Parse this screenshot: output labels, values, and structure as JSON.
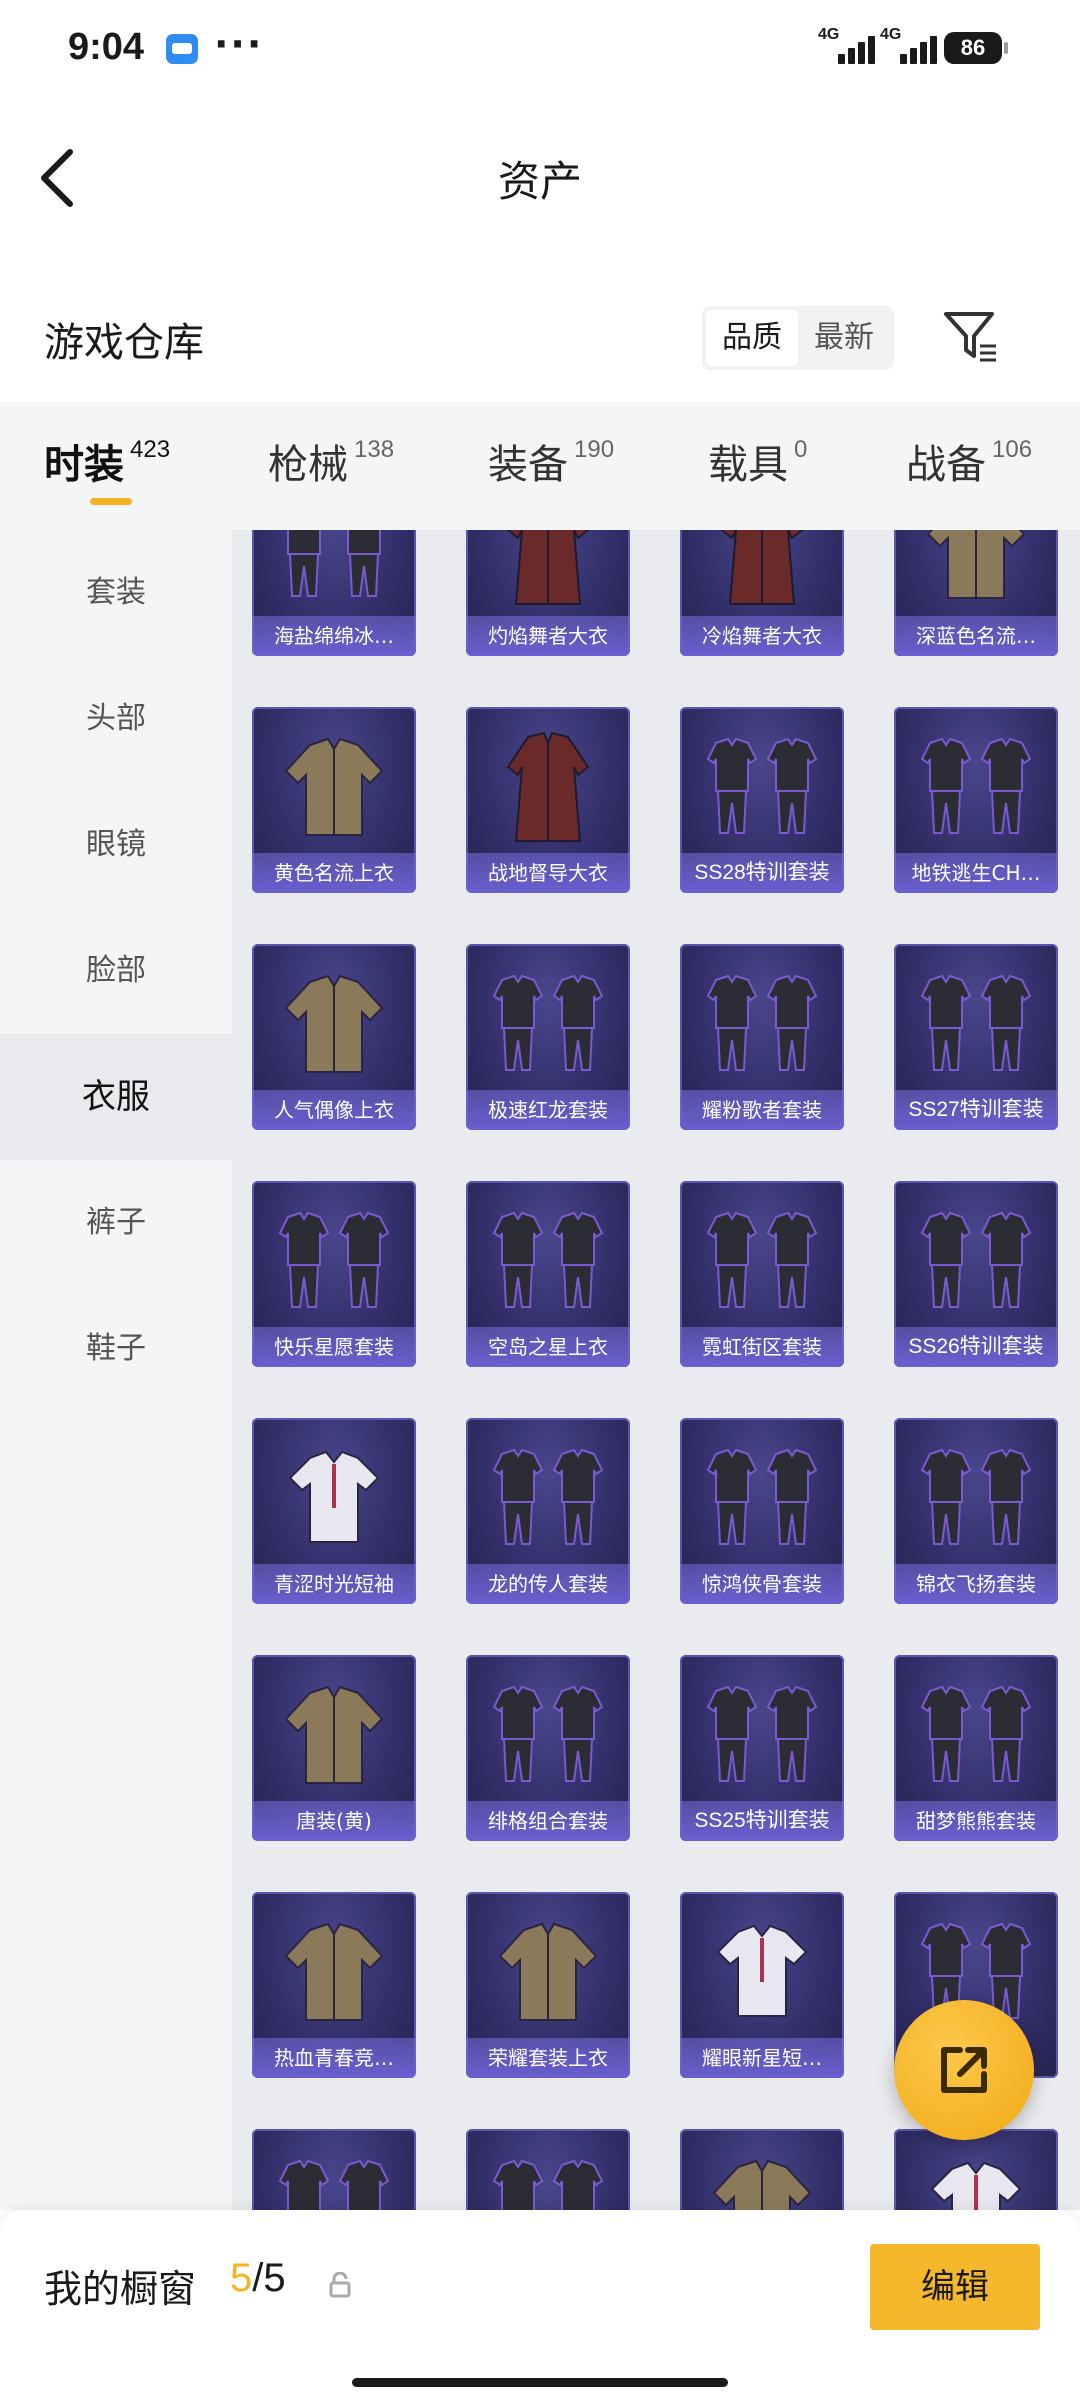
{
  "status_bar": {
    "time": "9:04",
    "more": "···",
    "network_1": "4G",
    "network_2": "4G",
    "battery": "86"
  },
  "nav": {
    "title": "资产"
  },
  "warehouse": {
    "title": "游戏仓库",
    "sort_options": [
      "品质",
      "最新"
    ],
    "active_sort": "品质"
  },
  "tabs": [
    {
      "label": "时装",
      "count": "423",
      "active": true
    },
    {
      "label": "枪械",
      "count": "138"
    },
    {
      "label": "装备",
      "count": "190"
    },
    {
      "label": "载具",
      "count": "0"
    },
    {
      "label": "战备",
      "count": "106"
    }
  ],
  "sidebar": {
    "items": [
      {
        "label": "套装"
      },
      {
        "label": "头部"
      },
      {
        "label": "眼镜"
      },
      {
        "label": "脸部"
      },
      {
        "label": "衣服",
        "active": true
      },
      {
        "label": "裤子"
      },
      {
        "label": "鞋子"
      }
    ]
  },
  "items": [
    {
      "name": "海盐绵绵冰…",
      "art": "outfit-set"
    },
    {
      "name": "灼焰舞者大衣",
      "art": "coat"
    },
    {
      "name": "冷焰舞者大衣",
      "art": "coat"
    },
    {
      "name": "深蓝色名流…",
      "art": "jacket"
    },
    {
      "name": "黄色名流上衣",
      "art": "jacket"
    },
    {
      "name": "战地督导大衣",
      "art": "coat"
    },
    {
      "name": "SS28特训套装",
      "art": "outfit-set"
    },
    {
      "name": "地铁逃生CH…",
      "art": "outfit-set"
    },
    {
      "name": "人气偶像上衣",
      "art": "jacket"
    },
    {
      "name": "极速红龙套装",
      "art": "outfit-set"
    },
    {
      "name": "耀粉歌者套装",
      "art": "outfit-set"
    },
    {
      "name": "SS27特训套装",
      "art": "outfit-set"
    },
    {
      "name": "快乐星愿套装",
      "art": "outfit-set"
    },
    {
      "name": "空岛之星上衣",
      "art": "outfit-set"
    },
    {
      "name": "霓虹街区套装",
      "art": "outfit-set"
    },
    {
      "name": "SS26特训套装",
      "art": "outfit-set"
    },
    {
      "name": "青涩时光短袖",
      "art": "shirt"
    },
    {
      "name": "龙的传人套装",
      "art": "outfit-set"
    },
    {
      "name": "惊鸿侠骨套装",
      "art": "outfit-set"
    },
    {
      "name": "锦衣飞扬套装",
      "art": "outfit-set"
    },
    {
      "name": "唐装(黄)",
      "art": "jacket"
    },
    {
      "name": "绯格组合套装",
      "art": "outfit-set"
    },
    {
      "name": "SS25特训套装",
      "art": "outfit-set"
    },
    {
      "name": "甜梦熊熊套装",
      "art": "outfit-set"
    },
    {
      "name": "热血青春竞…",
      "art": "jacket"
    },
    {
      "name": "荣耀套装上衣",
      "art": "jacket"
    },
    {
      "name": "耀眼新星短…",
      "art": "shirt"
    },
    {
      "name": "",
      "art": "outfit-set"
    },
    {
      "name": "",
      "art": "outfit-set"
    },
    {
      "name": "",
      "art": "outfit-set"
    },
    {
      "name": "",
      "art": "jacket"
    },
    {
      "name": "",
      "art": "shirt"
    }
  ],
  "showcase": {
    "label": "我的橱窗",
    "current": "5",
    "separator": "/",
    "total": "5",
    "edit_label": "编辑"
  },
  "colors": {
    "accent": "#f4b320",
    "card_bg": "#322f6a",
    "card_label": "#6a5fd0",
    "sidebar_bg": "#f4f5f7",
    "grid_bg": "#e9ebee"
  }
}
